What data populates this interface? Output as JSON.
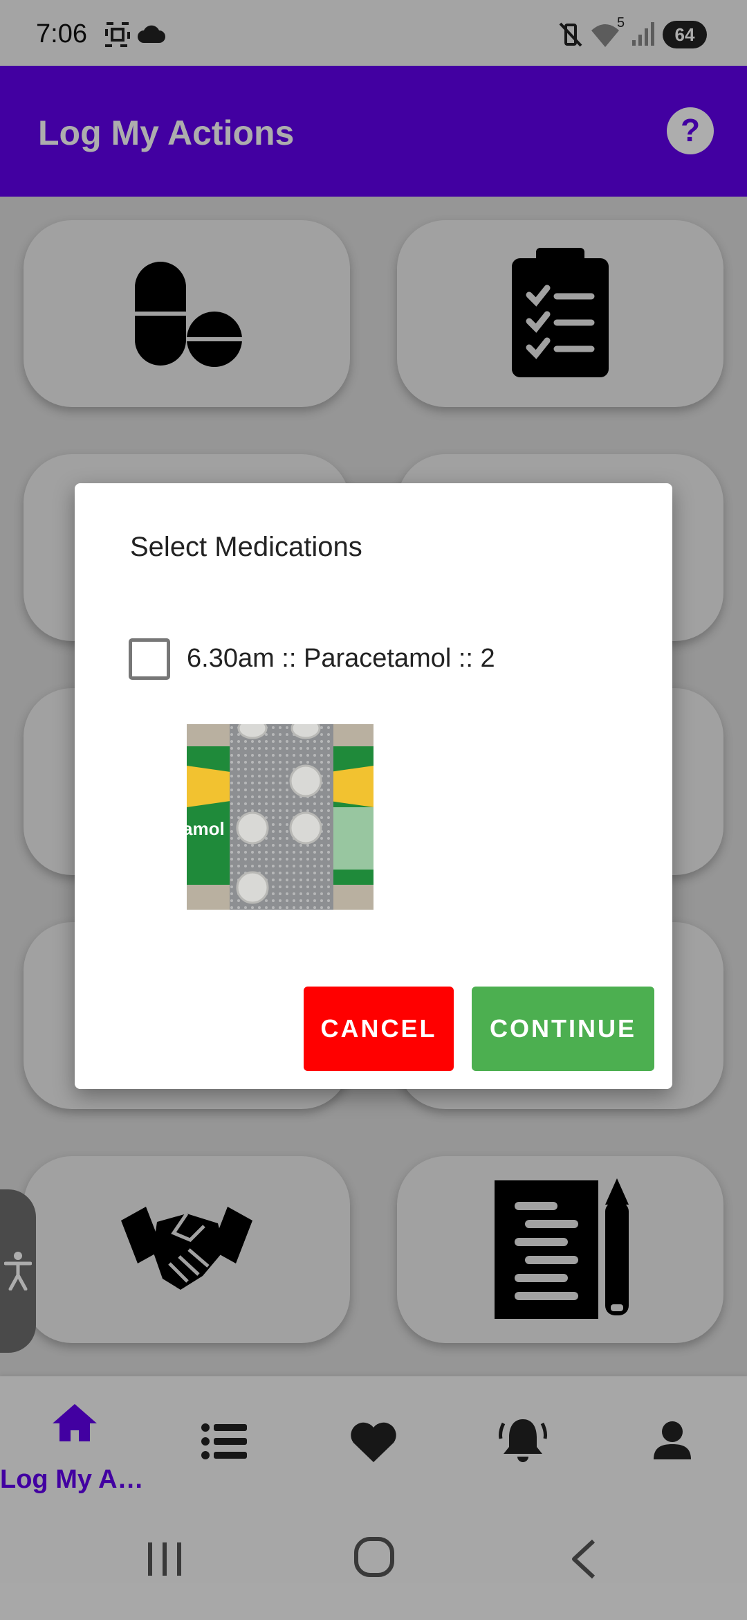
{
  "status_bar": {
    "time": "7:06",
    "battery": "64",
    "wifi_badge": "5",
    "icons": [
      "screenshot-icon",
      "cloud-icon",
      "mute-vibrate-icon",
      "wifi-icon",
      "signal-icon",
      "battery-icon"
    ]
  },
  "app_bar": {
    "title": "Log My Actions",
    "help_icon": "help-circle-icon"
  },
  "tiles": [
    {
      "icon": "pills-icon"
    },
    {
      "icon": "clipboard-checklist-icon"
    },
    {
      "icon": "unknown-tile-icon"
    },
    {
      "icon": "unknown-tile-icon"
    },
    {
      "icon": "unknown-tile-icon"
    },
    {
      "icon": "unknown-tile-icon"
    },
    {
      "icon": "unknown-tile-icon"
    },
    {
      "icon": "unknown-tile-icon"
    },
    {
      "icon": "handshake-icon"
    },
    {
      "icon": "notes-pencil-icon"
    }
  ],
  "dialog": {
    "title": "Select Medications",
    "medications": [
      {
        "label": "6.30am :: Paracetamol :: 2",
        "checked": false
      }
    ],
    "photo_text": "amol",
    "cancel_label": "CANCEL",
    "continue_label": "CONTINUE"
  },
  "bottom_nav": {
    "items": [
      {
        "icon": "home-icon",
        "label": "Log My A…",
        "active": true
      },
      {
        "icon": "list-icon",
        "label": ""
      },
      {
        "icon": "heart-icon",
        "label": ""
      },
      {
        "icon": "alarm-bell-icon",
        "label": ""
      },
      {
        "icon": "person-icon",
        "label": ""
      }
    ]
  },
  "system_nav": {
    "buttons": [
      "recents-icon",
      "home-circle-icon",
      "back-icon"
    ]
  },
  "accessibility": {
    "icon": "accessibility-icon"
  },
  "colors": {
    "primary": "#6200ee",
    "cancel": "#ff0000",
    "continue": "#4caf50"
  }
}
